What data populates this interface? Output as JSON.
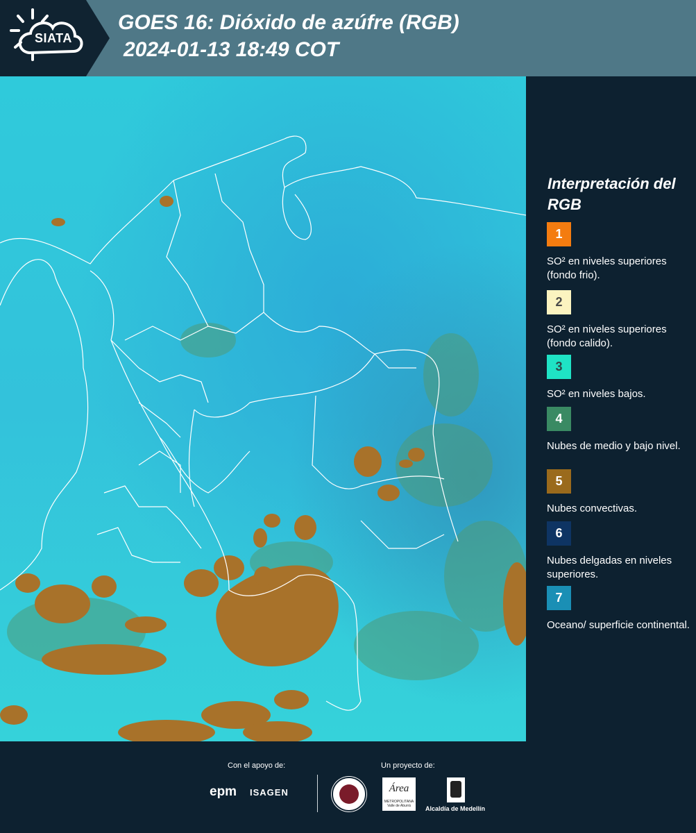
{
  "header": {
    "logo_text": "SIATA",
    "title_line1": "GOES 16: Dióxido de azúfre (RGB)",
    "title_line2": "2024-01-13 18:49 COT"
  },
  "legend": {
    "title": "Interpretación del RGB",
    "items": [
      {
        "number": "1",
        "color": "#f47c10",
        "num_color": "#ffffff",
        "label": "SO² en niveles superiores (fondo frio)."
      },
      {
        "number": "2",
        "color": "#fbf3c0",
        "num_color": "#4a4a4a",
        "label": "SO² en niveles superiores (fondo calido)."
      },
      {
        "number": "3",
        "color": "#1fe3c5",
        "num_color": "#2d4a4a",
        "label": "SO² en niveles bajos."
      },
      {
        "number": "4",
        "color": "#3a8a63",
        "num_color": "#ffffff",
        "label": "Nubes de medio y bajo nivel."
      },
      {
        "number": "5",
        "color": "#9a6a1c",
        "num_color": "#ffffff",
        "label": "Nubes convectivas."
      },
      {
        "number": "6",
        "color": "#0e3463",
        "num_color": "#ffffff",
        "label": "Nubes delgadas en niveles superiores."
      },
      {
        "number": "7",
        "color": "#1a8fb5",
        "num_color": "#ffffff",
        "label": "Oceano/ superficie continental."
      }
    ]
  },
  "footer": {
    "support_label": "Con el apoyo de:",
    "project_label": "Un proyecto de:",
    "epm_label": "epm",
    "isagen_label": "ISAGEN",
    "area_label": "Área",
    "area_sub_label": "METROPOLITANA Valle de Aburrá",
    "alcaldia_label": "Alcaldía de Medellín"
  },
  "map": {
    "ocean_color": "#2cc7d8",
    "land_color": "#3bb7d6",
    "convective_color": "#a8722a",
    "border_color": "#ffffff"
  }
}
